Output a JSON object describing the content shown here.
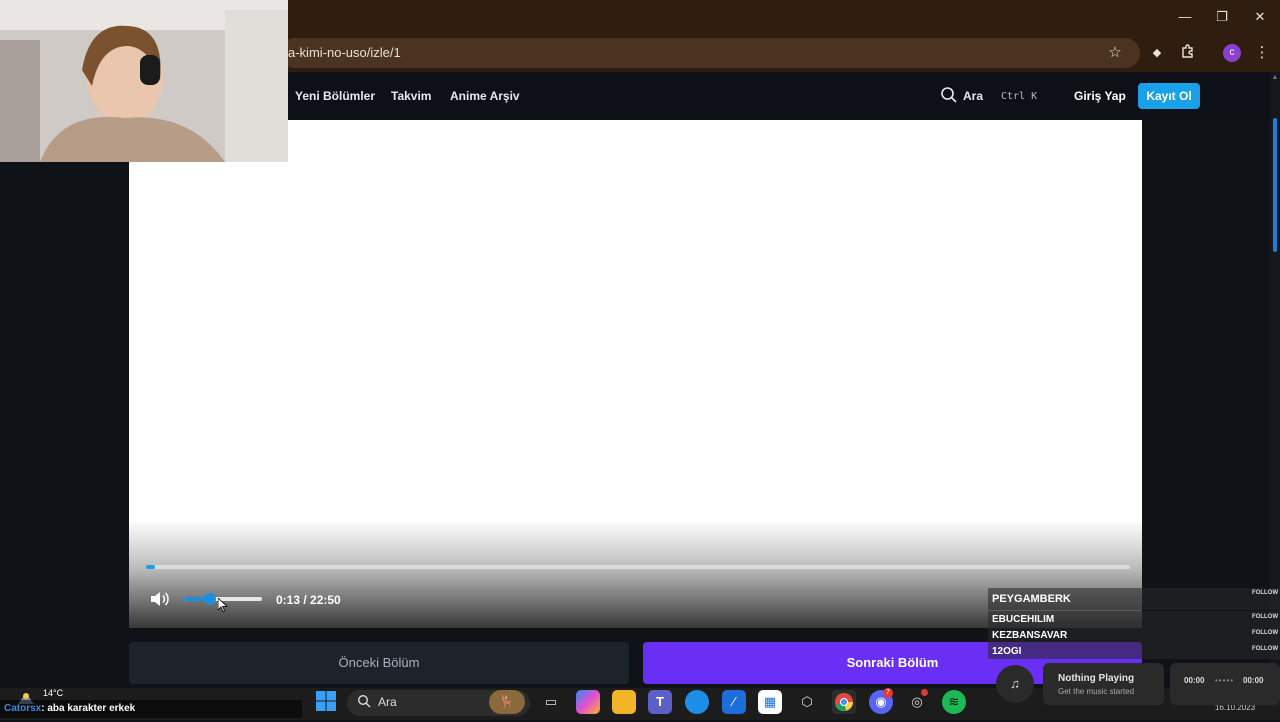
{
  "browser": {
    "url": "a-kimi-no-uso/izle/1",
    "profile_letter": "c",
    "window_controls": {
      "minimize": "—",
      "maximize": "❐",
      "close": "✕"
    },
    "icons": {
      "bookmark": "star-icon",
      "extension": "puzzle-icon",
      "menu": "kebab-menu-icon"
    }
  },
  "site": {
    "nav": [
      "Yeni Bölümler",
      "Takvim",
      "Anime Arşiv"
    ],
    "search_label": "Ara",
    "search_shortcut": "Ctrl K",
    "login": "Giriş Yap",
    "register": "Kayıt Ol",
    "accent": "#1aa0e8"
  },
  "player": {
    "time": "0:13 / 22:50",
    "progress_fraction": 0.0095,
    "volume_fraction": 0.33
  },
  "episodes": {
    "prev": "Önceki Bölüm",
    "next": "Sonraki Bölüm",
    "next_color": "#6a2ff5"
  },
  "followers": {
    "tag": "FOLLOW",
    "names": [
      "PEYGAMBERK",
      "EBUCEHILIM",
      "KEZBANSAVAR",
      "12OGI"
    ]
  },
  "taskbar": {
    "search_label": "Ara",
    "weather": "14°C",
    "chat_user": "Catorsx",
    "chat_message": ": aba karakter erkek",
    "clock": "16.10.2023",
    "discord_badge": "7"
  },
  "music": {
    "title": "Nothing Playing",
    "subtitle": "Get the music started",
    "time_start": "00:00",
    "time_end": "00:00"
  }
}
